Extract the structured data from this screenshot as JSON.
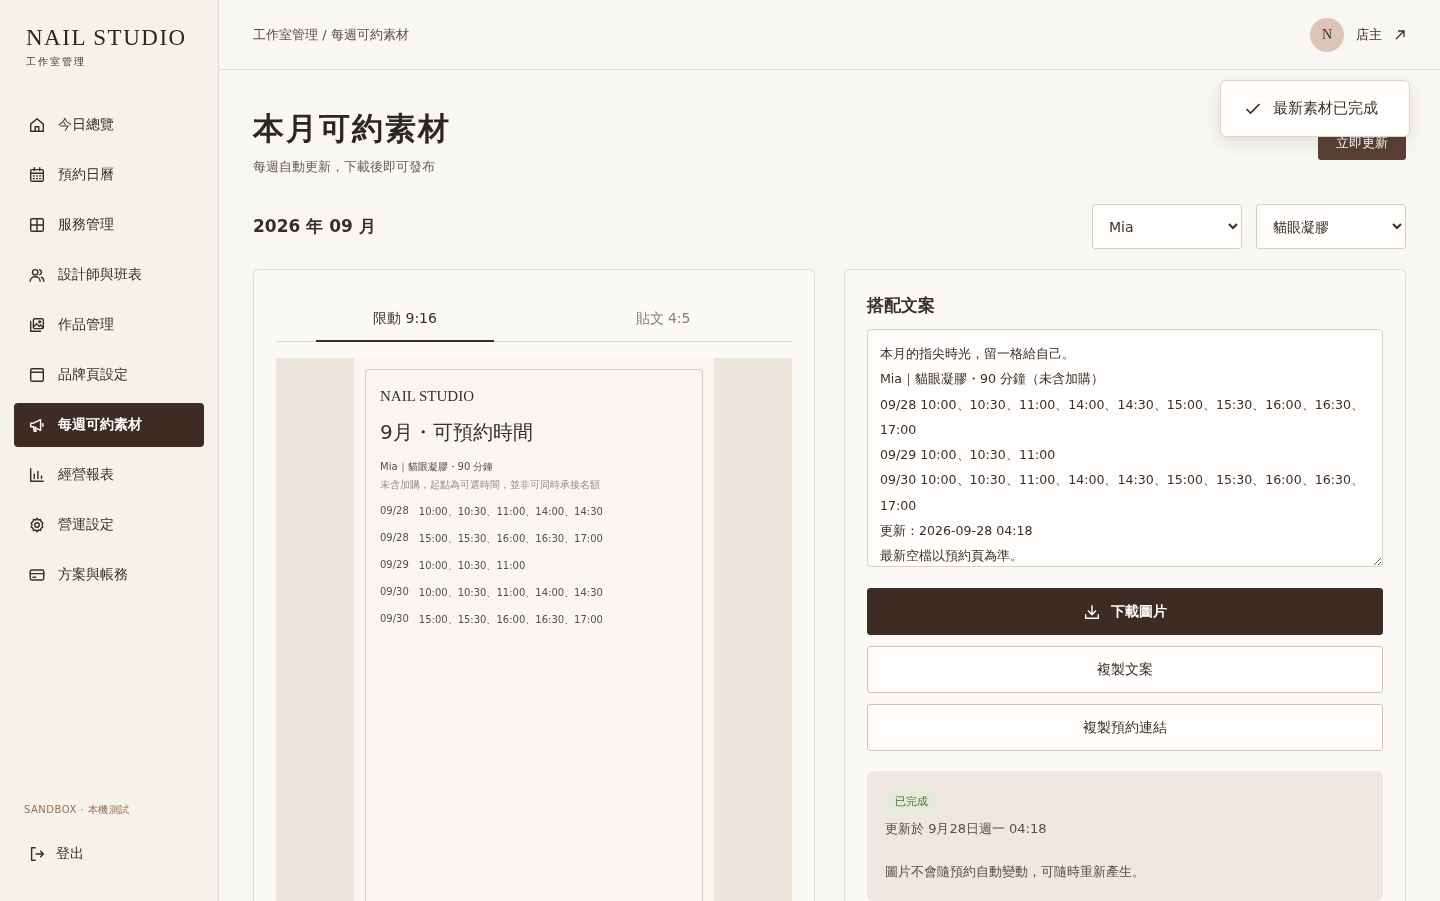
{
  "sidebar": {
    "brand": "NAIL STUDIO",
    "brand_sub": "工作室管理",
    "items": [
      {
        "label": "今日總覽",
        "selected": false
      },
      {
        "label": "預約日曆",
        "selected": false
      },
      {
        "label": "服務管理",
        "selected": false
      },
      {
        "label": "設計師與班表",
        "selected": false
      },
      {
        "label": "作品管理",
        "selected": false
      },
      {
        "label": "品牌頁設定",
        "selected": false
      },
      {
        "label": "每週可約素材",
        "selected": true
      },
      {
        "label": "經營報表",
        "selected": false
      },
      {
        "label": "營運設定",
        "selected": false
      },
      {
        "label": "方案與帳務",
        "selected": false
      }
    ],
    "env": "SANDBOX · 本機測試",
    "logout": "登出"
  },
  "header": {
    "breadcrumb": "工作室管理 / 每週可約素材",
    "avatar": "N",
    "user": "店主"
  },
  "toast": {
    "text": "最新素材已完成"
  },
  "page": {
    "title": "本月可約素材",
    "subtitle": "每週自動更新，下載後即可發布",
    "refresh_button": "立即更新",
    "month": "2026 年 09 月",
    "filters": [
      {
        "value": "Mia"
      },
      {
        "value": "貓眼凝膠"
      }
    ]
  },
  "preview": {
    "tabs": [
      {
        "label": "限動 9:16",
        "selected": true
      },
      {
        "label": "貼文 4:5",
        "selected": false
      }
    ],
    "brand": "NAIL STUDIO",
    "title": "9月・可預約時間",
    "service": "Mia｜貓眼凝膠・90 分鐘",
    "note": "未含加購，起點為可選時間，並非可同時承接名額",
    "rows": [
      {
        "date": "09/28",
        "times": "10:00、10:30、11:00、14:00、14:30"
      },
      {
        "date": "09/28",
        "times": "15:00、15:30、16:00、16:30、17:00"
      },
      {
        "date": "09/29",
        "times": "10:00、10:30、11:00"
      },
      {
        "date": "09/30",
        "times": "10:00、10:30、11:00、14:00、14:30"
      },
      {
        "date": "09/30",
        "times": "15:00、15:30、16:00、16:30、17:00"
      }
    ]
  },
  "caption_panel": {
    "title": "搭配文案",
    "caption": "本月的指尖時光，留一格給自己。\nMia｜貓眼凝膠・90 分鐘（未含加購）\n09/28 10:00、10:30、11:00、14:00、14:30、15:00、15:30、16:00、16:30、17:00\n09/29 10:00、10:30、11:00\n09/30 10:00、10:30、11:00、14:00、14:30、15:00、15:30、16:00、16:30、17:00\n更新：2026-09-28 04:18\n最新空檔以預約頁為準。",
    "buttons": [
      {
        "label": "下載圖片",
        "kind": "primary"
      },
      {
        "label": "複製文案",
        "kind": "outline"
      },
      {
        "label": "複製預約連結",
        "kind": "outline"
      }
    ],
    "status": {
      "badge": "已完成",
      "updated": "更新於 9月28日週一 04:18",
      "note": "圖片不會隨預約自動變動，可隨時重新產生。"
    }
  }
}
